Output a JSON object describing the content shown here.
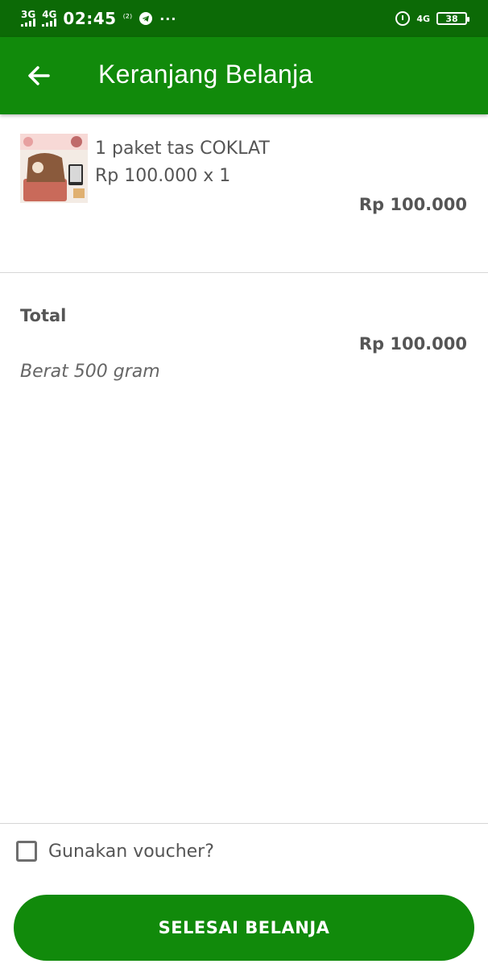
{
  "status_bar": {
    "net1": "3G",
    "net2": "4G",
    "time": "02:45",
    "extra": "⁽²⁾",
    "more": "···",
    "net_right": "4G",
    "battery": "38"
  },
  "app_bar": {
    "title": "Keranjang Belanja",
    "back_icon": "arrow-left-icon"
  },
  "cart": {
    "items": [
      {
        "name": "1 paket tas COKLAT",
        "price_qty": "Rp 100.000 x 1",
        "subtotal": "Rp 100.000"
      }
    ]
  },
  "summary": {
    "total_label": "Total",
    "total_value": "Rp 100.000",
    "weight": "Berat 500 gram"
  },
  "voucher": {
    "label": "Gunakan voucher?",
    "checked": false
  },
  "actions": {
    "finish_label": "SELESAI BELANJA"
  },
  "colors": {
    "status_bar": "#0c6a06",
    "primary": "#118a0b",
    "text": "#555555"
  }
}
